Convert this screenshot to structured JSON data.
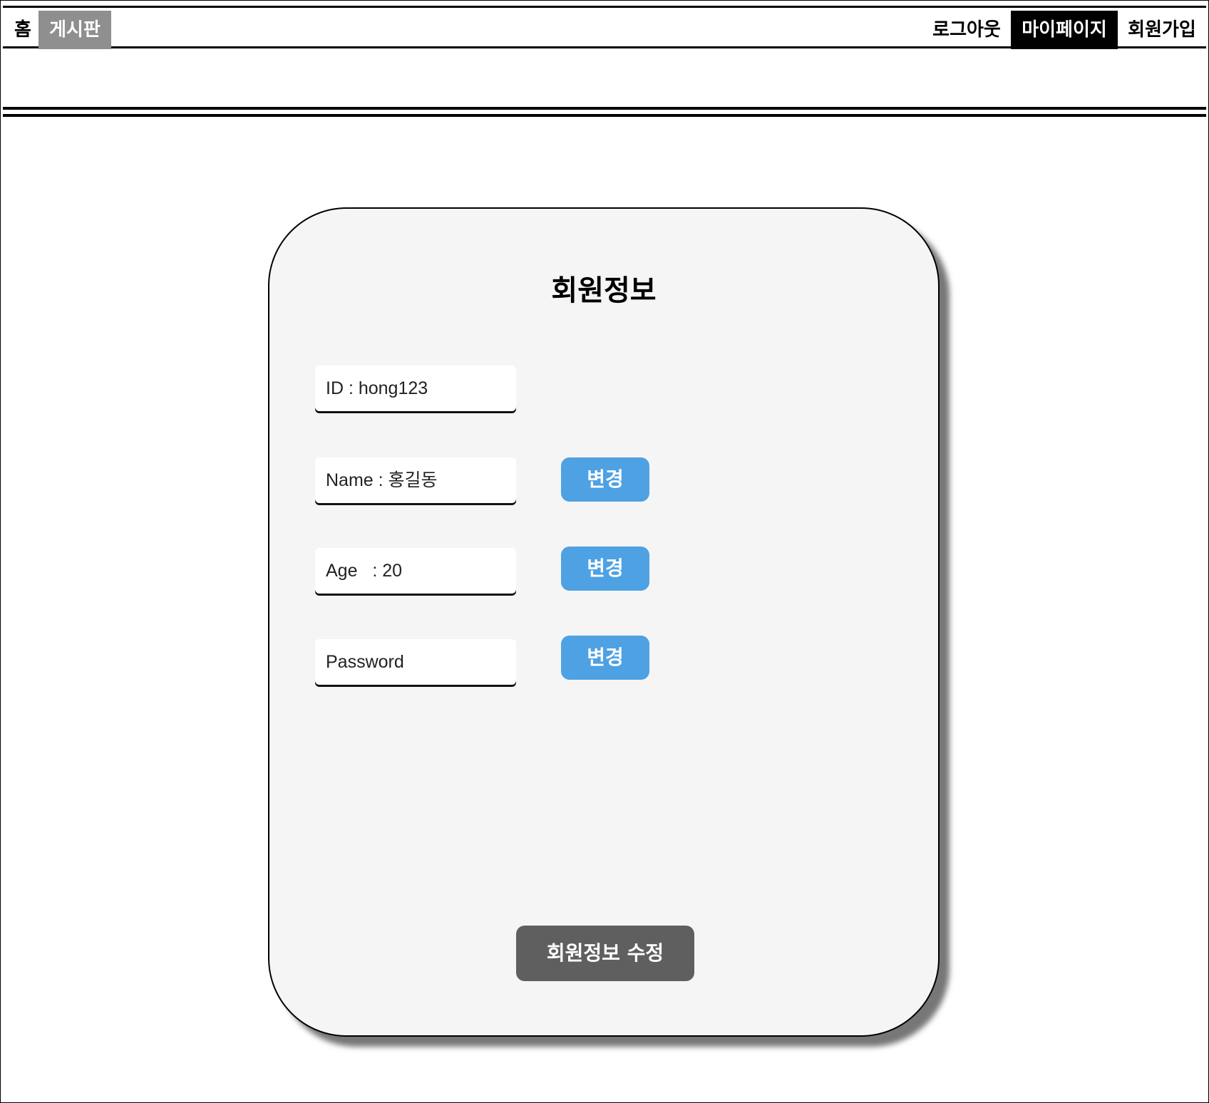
{
  "nav": {
    "home": "홈",
    "board": "게시판",
    "logout": "로그아웃",
    "mypage": "마이페이지",
    "signup": "회원가입"
  },
  "card": {
    "title": "회원정보",
    "fields": {
      "id": "ID : hong123",
      "name": "Name : 홍길동",
      "age": "Age   : 20",
      "password": "Password"
    },
    "change_label": "변경",
    "submit_label": "회원정보 수정"
  },
  "colors": {
    "change_button": "#4ea1e3",
    "submit_button": "#5f5f5f",
    "active_nav": "#000000",
    "board_nav": "#8f8f8f",
    "card_background": "#f5f5f5"
  }
}
